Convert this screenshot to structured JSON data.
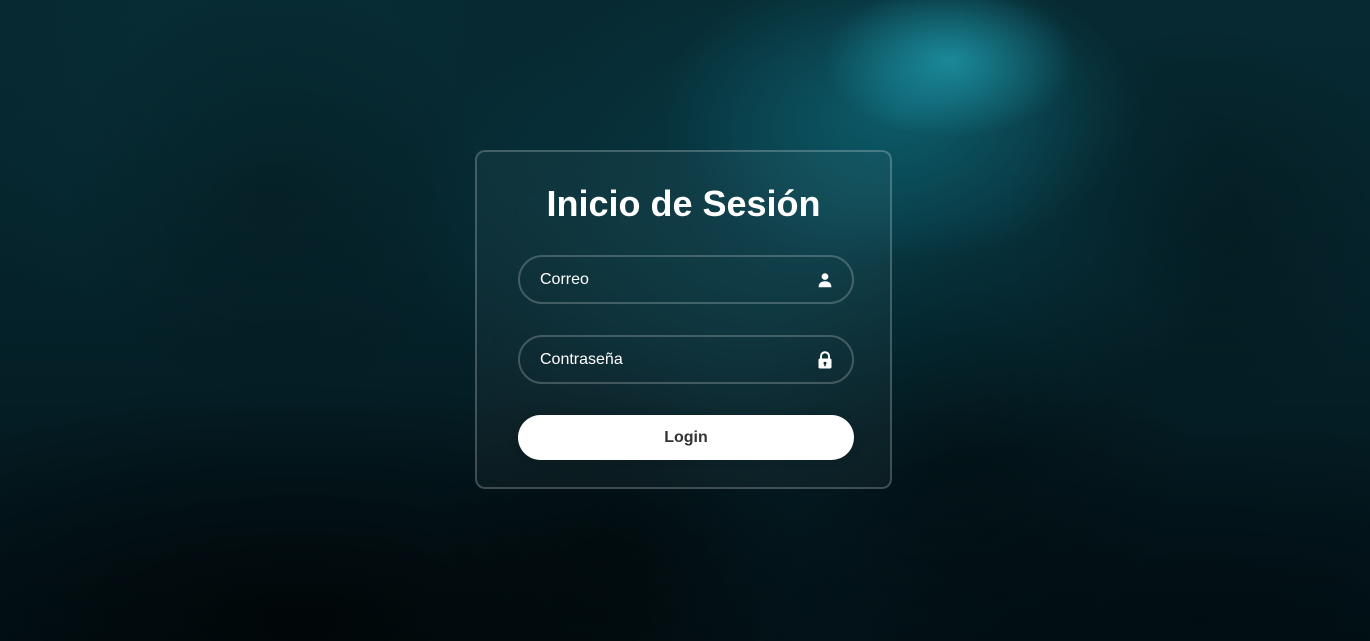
{
  "login_form": {
    "title": "Inicio de Sesión",
    "email_placeholder": "Correo",
    "email_value": "",
    "email_icon": "user-icon",
    "password_placeholder": "Contraseña",
    "password_value": "",
    "password_icon": "lock-icon",
    "login_label": "Login"
  },
  "colors": {
    "background": "#05222a",
    "accent_glow": "#28bed2",
    "text": "#ffffff",
    "button_bg": "#ffffff",
    "button_text": "#333333"
  }
}
